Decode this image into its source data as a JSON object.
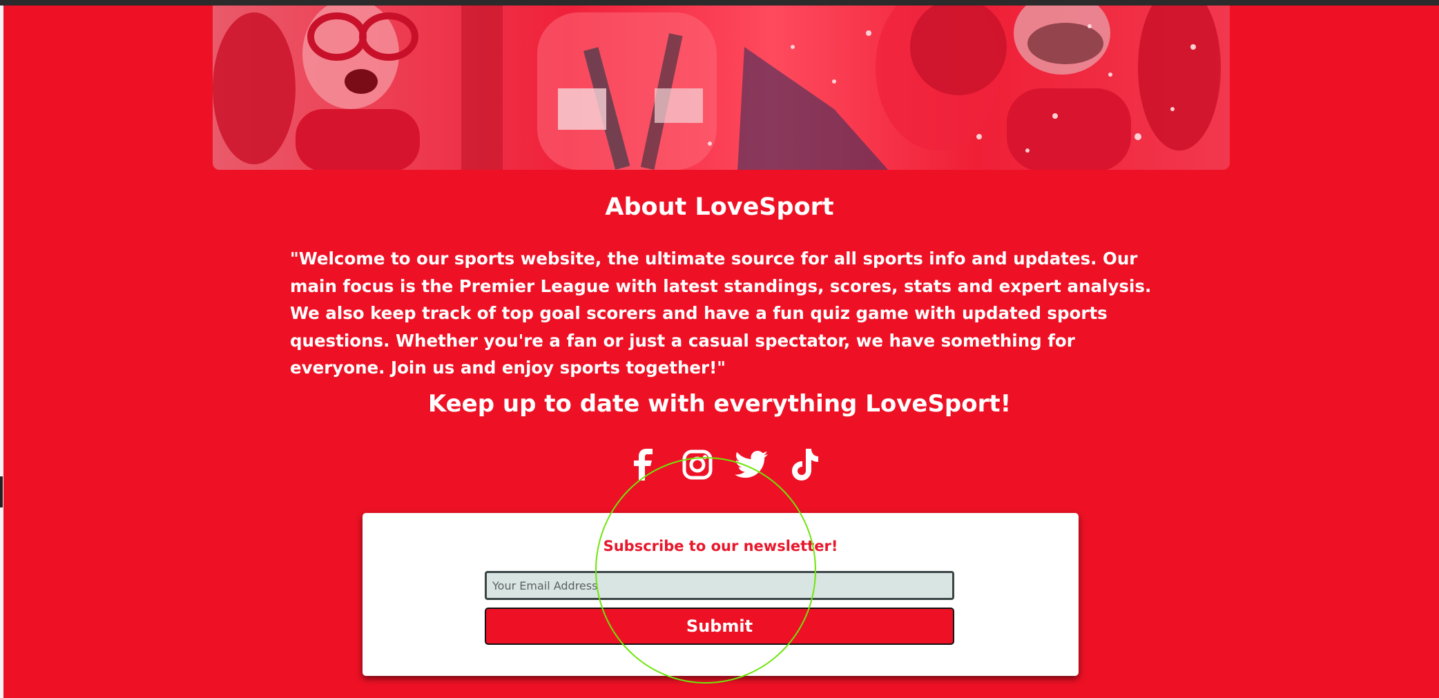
{
  "about": {
    "title": "About LoveSport",
    "text": "\"Welcome to our sports website, the ultimate source for all sports info and updates. Our main focus is the Premier League with latest standings, scores, stats and expert analysis. We also keep track of top goal scorers and have a fun quiz game with updated sports questions. Whether you're a fan or just a casual spectator, we have something for everyone. Join us and enjoy sports together!\""
  },
  "social": {
    "title": "Keep up to date with everything LoveSport!",
    "icons": [
      "facebook-icon",
      "instagram-icon",
      "twitter-icon",
      "tiktok-icon"
    ]
  },
  "newsletter": {
    "title": "Subscribe to our newsletter!",
    "email_placeholder": "Your Email Address",
    "submit_label": "Submit"
  },
  "colors": {
    "background": "#ee1125",
    "text": "#ffffff",
    "card": "#ffffff",
    "input_bg": "#d9e5e2",
    "cursor_ring": "#6ee60a"
  }
}
